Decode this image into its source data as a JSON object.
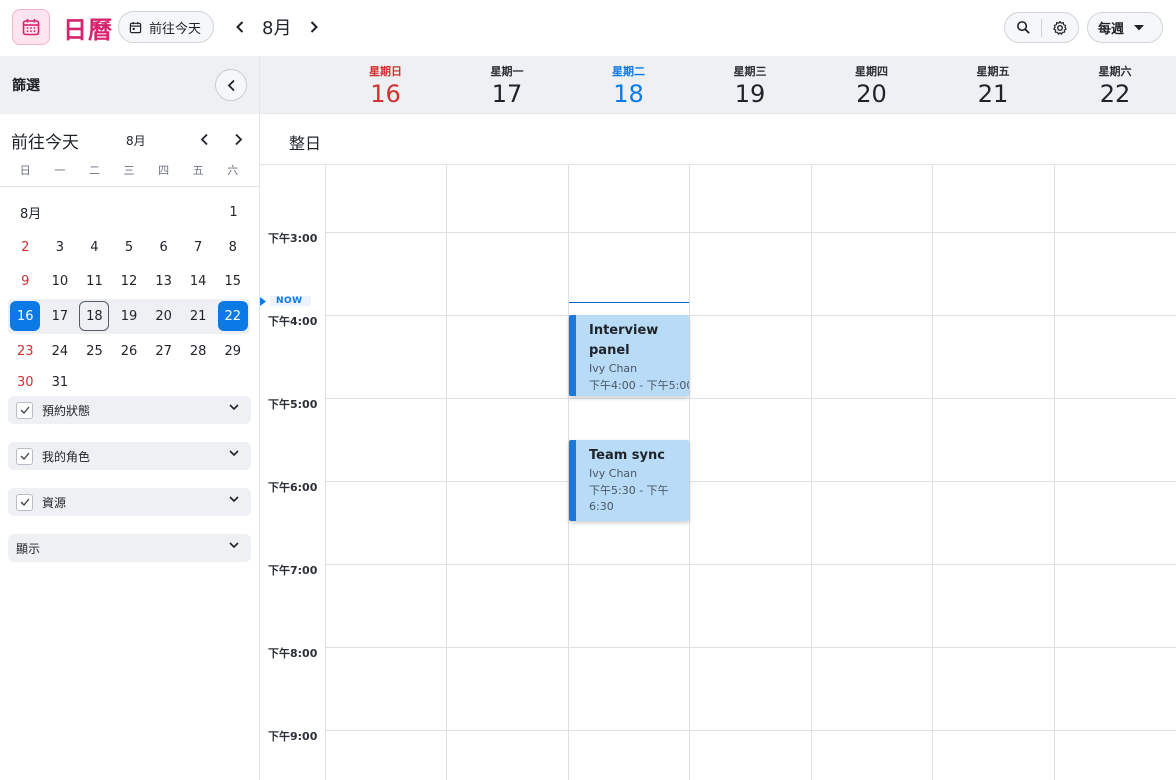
{
  "app": {
    "title": "日曆"
  },
  "toolbar": {
    "today_label": "前往今天",
    "month_label": "8月",
    "view_label": "每週"
  },
  "sidebar": {
    "filter_title": "篩選",
    "mini_calendar": {
      "today_label": "前往今天",
      "month_label": "8月",
      "weekdays": [
        "日",
        "一",
        "二",
        "三",
        "四",
        "五",
        "六"
      ],
      "month_inline_label": "8月",
      "weeks": [
        [
          "",
          "",
          "",
          "",
          "",
          "",
          "1"
        ],
        [
          "2",
          "3",
          "4",
          "5",
          "6",
          "7",
          "8"
        ],
        [
          "9",
          "10",
          "11",
          "12",
          "13",
          "14",
          "15"
        ],
        [
          "16",
          "17",
          "18",
          "19",
          "20",
          "21",
          "22"
        ],
        [
          "23",
          "24",
          "25",
          "26",
          "27",
          "28",
          "29"
        ],
        [
          "30",
          "31",
          "",
          "",
          "",
          "",
          ""
        ]
      ]
    },
    "filters": [
      {
        "label": "預約狀態"
      },
      {
        "label": "我的角色"
      },
      {
        "label": "資源"
      },
      {
        "label": "顯示"
      }
    ]
  },
  "week": {
    "days": [
      {
        "dow": "星期日",
        "num": "16"
      },
      {
        "dow": "星期一",
        "num": "17"
      },
      {
        "dow": "星期二",
        "num": "18"
      },
      {
        "dow": "星期三",
        "num": "19"
      },
      {
        "dow": "星期四",
        "num": "20"
      },
      {
        "dow": "星期五",
        "num": "21"
      },
      {
        "dow": "星期六",
        "num": "22"
      }
    ],
    "allday_label": "整日",
    "time_labels": [
      "下午3:00",
      "下午4:00",
      "下午5:00",
      "下午6:00",
      "下午7:00",
      "下午8:00",
      "下午9:00"
    ],
    "now_label": "NOW"
  },
  "events": [
    {
      "title": "Interview panel",
      "person": "Ivy Chan",
      "time": "下午4:00 - 下午5:00"
    },
    {
      "title": "Team sync",
      "person": "Ivy Chan",
      "time": "下午5:30 - 下午6:30"
    }
  ],
  "colors": {
    "brand": "#d6246e",
    "accent": "#0b7ae6",
    "event_bg": "#b8dcf8",
    "event_bar": "#1e78d8",
    "sunday": "#d32f2f"
  }
}
